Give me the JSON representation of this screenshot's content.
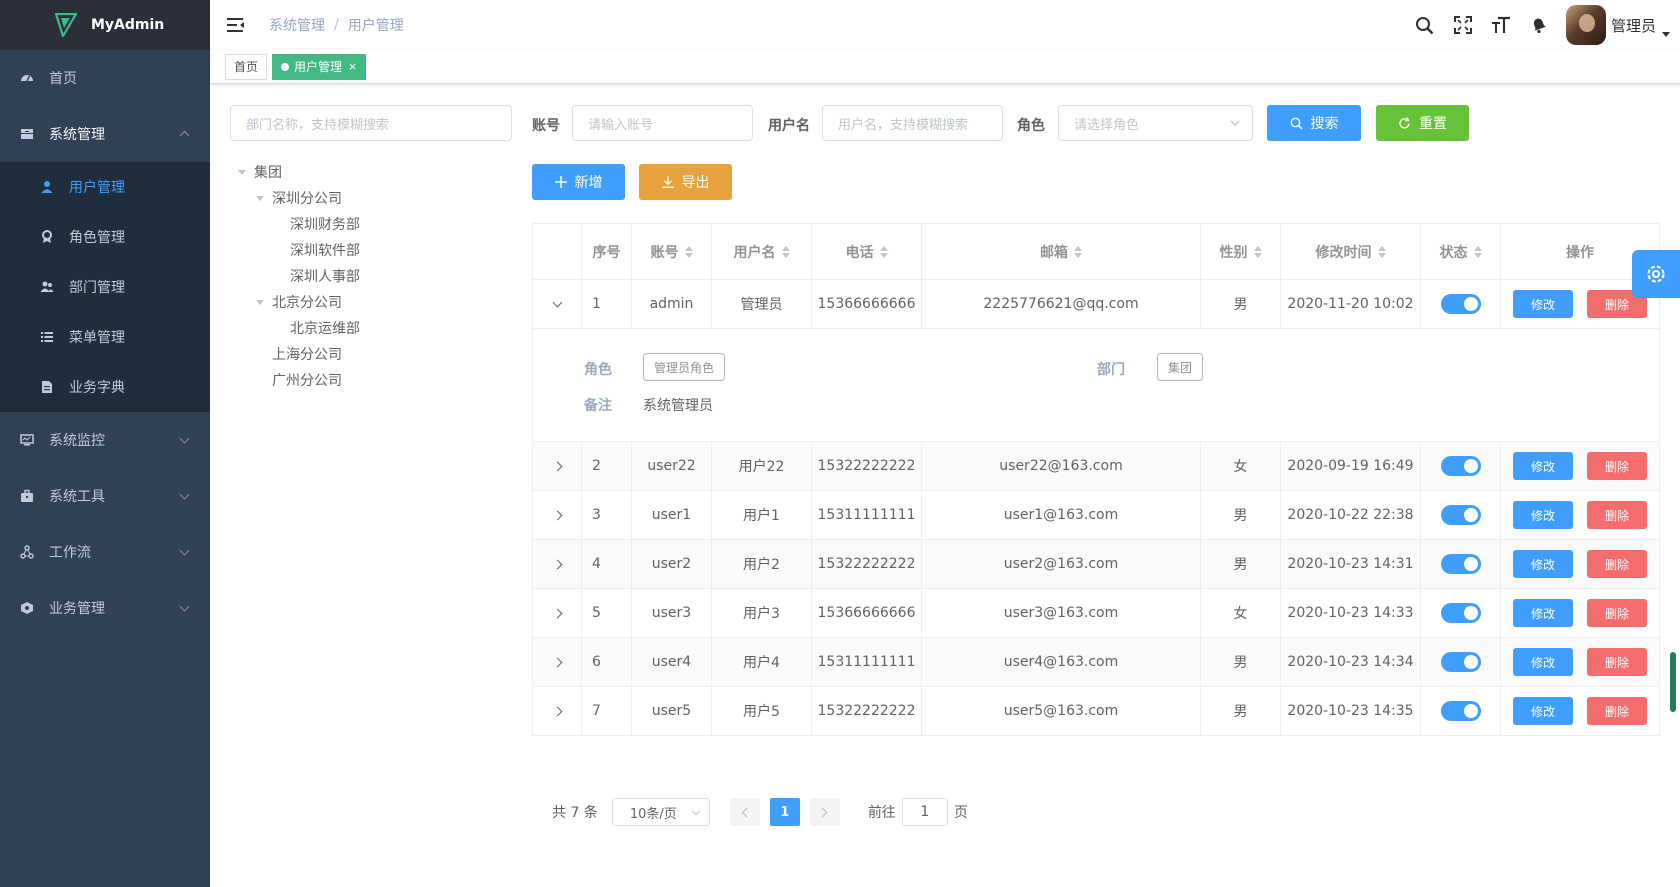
{
  "app": {
    "title": "MyAdmin"
  },
  "sidebar": {
    "items": [
      {
        "label": "首页",
        "icon": "dashboard-icon"
      },
      {
        "label": "系统管理",
        "icon": "system-icon"
      },
      {
        "label": "系统监控",
        "icon": "monitor-icon"
      },
      {
        "label": "系统工具",
        "icon": "tool-icon"
      },
      {
        "label": "工作流",
        "icon": "workflow-icon"
      },
      {
        "label": "业务管理",
        "icon": "business-icon"
      }
    ],
    "submenu": [
      {
        "label": "用户管理",
        "icon": "user-icon"
      },
      {
        "label": "角色管理",
        "icon": "role-icon"
      },
      {
        "label": "部门管理",
        "icon": "department-icon"
      },
      {
        "label": "菜单管理",
        "icon": "menu-icon"
      },
      {
        "label": "业务字典",
        "icon": "dictionary-icon"
      }
    ]
  },
  "navbar": {
    "breadcrumb": [
      "系统管理",
      "用户管理"
    ],
    "username": "管理员"
  },
  "tags": {
    "home": "首页",
    "current": "用户管理",
    "close": "×"
  },
  "tree": {
    "placeholder": "部门名称，支持模糊搜索",
    "nodes": [
      "集团",
      "深圳分公司",
      "深圳财务部",
      "深圳软件部",
      "深圳人事部",
      "北京分公司",
      "北京运维部",
      "上海分公司",
      "广州分公司"
    ]
  },
  "search": {
    "account_label": "账号",
    "account_placeholder": "请输入账号",
    "username_label": "用户名",
    "username_placeholder": "用户名，支持模糊搜索",
    "role_label": "角色",
    "role_placeholder": "请选择角色",
    "search_btn": "搜索",
    "reset_btn": "重置"
  },
  "actions": {
    "add": "新增",
    "export": "导出"
  },
  "table": {
    "headers": [
      "序号",
      "账号",
      "用户名",
      "电话",
      "邮箱",
      "性别",
      "修改时间",
      "状态",
      "操作"
    ],
    "edit_label": "修改",
    "delete_label": "删除",
    "rows": [
      {
        "no": "1",
        "account": "admin",
        "name": "管理员",
        "phone": "15366666666",
        "email": "2225776621@qq.com",
        "gender": "男",
        "time": "2020-11-20 10:02",
        "enabled": true
      },
      {
        "no": "2",
        "account": "user22",
        "name": "用户22",
        "phone": "15322222222",
        "email": "user22@163.com",
        "gender": "女",
        "time": "2020-09-19 16:49",
        "enabled": true
      },
      {
        "no": "3",
        "account": "user1",
        "name": "用户1",
        "phone": "15311111111",
        "email": "user1@163.com",
        "gender": "男",
        "time": "2020-10-22 22:38",
        "enabled": true
      },
      {
        "no": "4",
        "account": "user2",
        "name": "用户2",
        "phone": "15322222222",
        "email": "user2@163.com",
        "gender": "男",
        "time": "2020-10-23 14:31",
        "enabled": true
      },
      {
        "no": "5",
        "account": "user3",
        "name": "用户3",
        "phone": "15366666666",
        "email": "user3@163.com",
        "gender": "女",
        "time": "2020-10-23 14:33",
        "enabled": true
      },
      {
        "no": "6",
        "account": "user4",
        "name": "用户4",
        "phone": "15311111111",
        "email": "user4@163.com",
        "gender": "男",
        "time": "2020-10-23 14:34",
        "enabled": true
      },
      {
        "no": "7",
        "account": "user5",
        "name": "用户5",
        "phone": "15322222222",
        "email": "user5@163.com",
        "gender": "男",
        "time": "2020-10-23 14:35",
        "enabled": true
      }
    ],
    "expanded": {
      "role_label": "角色",
      "role_value": "管理员角色",
      "dept_label": "部门",
      "dept_value": "集团",
      "remark_label": "备注",
      "remark_value": "系统管理员"
    }
  },
  "pagination": {
    "total": "共 7 条",
    "page_size": "10条/页",
    "current": "1",
    "goto_label": "前往",
    "goto_value": "1",
    "page_suffix": "页"
  },
  "colors": {
    "primary": "#409eff",
    "success": "#67c23a",
    "warning": "#e6a23c",
    "danger": "#f56c6c",
    "sidebar": "#304156",
    "tag_active": "#42b983"
  }
}
